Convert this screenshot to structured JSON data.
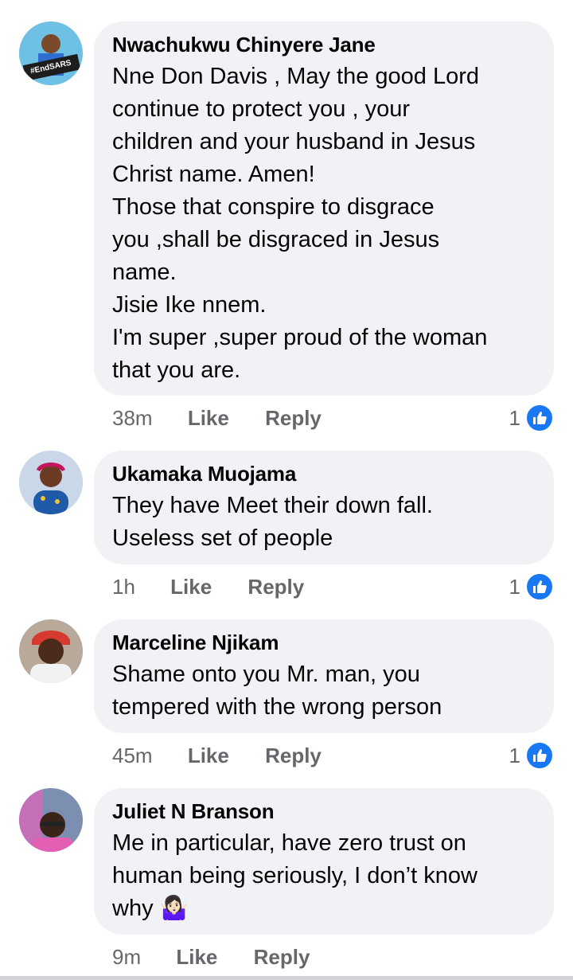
{
  "comments": [
    {
      "author": "Nwachukwu Chinyere Jane",
      "avatar_badge": "#EndSARS",
      "text": "Nne Don Davis , May the good Lord\ncontinue to protect you , your\nchildren and your husband in Jesus\nChrist name. Amen!\nThose that conspire to disgrace\nyou ,shall be disgraced in Jesus\nname.\nJisie Ike nnem.\nI'm super ,super proud of the woman\nthat you are.",
      "time": "38m",
      "like_label": "Like",
      "reply_label": "Reply",
      "reactions": "1"
    },
    {
      "author": "Ukamaka Muojama",
      "text": "They have Meet their down fall.\nUseless set of people",
      "time": "1h",
      "like_label": "Like",
      "reply_label": "Reply",
      "reactions": "1"
    },
    {
      "author": "Marceline Njikam",
      "text": "Shame onto you Mr. man, you\ntempered with the wrong person",
      "time": "45m",
      "like_label": "Like",
      "reply_label": "Reply",
      "reactions": "1"
    },
    {
      "author": "Juliet N Branson",
      "text": "Me in particular, have zero trust on\nhuman being seriously, I don’t know\nwhy 🤷🏻‍♀️",
      "time": "9m",
      "like_label": "Like",
      "reply_label": "Reply"
    }
  ],
  "icons": {
    "like_reaction": "thumbs-up-icon"
  },
  "colors": {
    "bubble": "#f0f2f5",
    "meta_text": "#65676b",
    "like_blue": "#1877f2"
  }
}
